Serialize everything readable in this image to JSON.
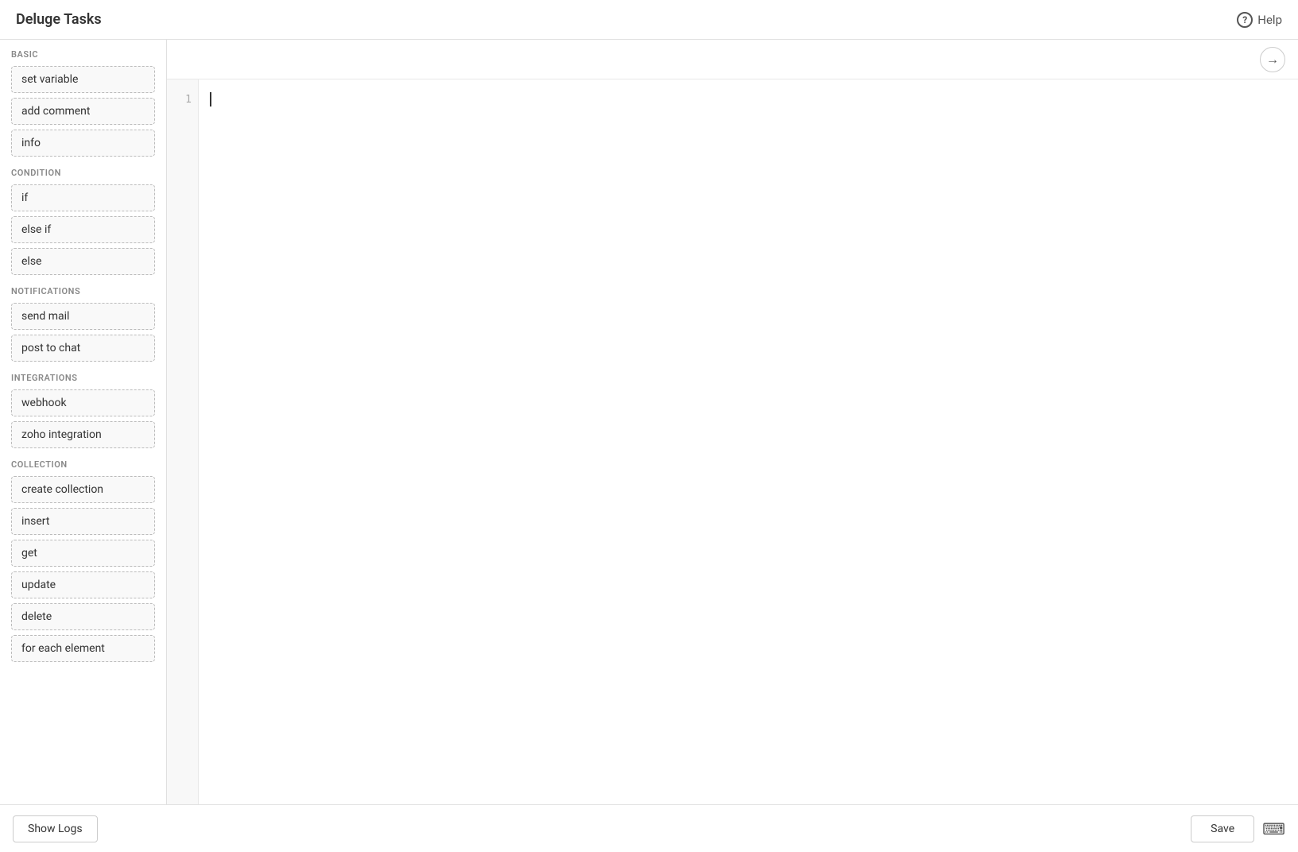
{
  "app": {
    "title": "Deluge Tasks",
    "help_label": "Help"
  },
  "sidebar": {
    "sections": [
      {
        "label": "BASIC",
        "id": "basic",
        "items": [
          {
            "id": "set-variable",
            "label": "set variable"
          },
          {
            "id": "add-comment",
            "label": "add comment"
          },
          {
            "id": "info",
            "label": "info"
          }
        ]
      },
      {
        "label": "CONDITION",
        "id": "condition",
        "items": [
          {
            "id": "if",
            "label": "if"
          },
          {
            "id": "else-if",
            "label": "else if"
          },
          {
            "id": "else",
            "label": "else"
          }
        ]
      },
      {
        "label": "NOTIFICATIONS",
        "id": "notifications",
        "items": [
          {
            "id": "send-mail",
            "label": "send mail"
          },
          {
            "id": "post-to-chat",
            "label": "post to chat"
          }
        ]
      },
      {
        "label": "INTEGRATIONS",
        "id": "integrations",
        "items": [
          {
            "id": "webhook",
            "label": "webhook"
          },
          {
            "id": "zoho-integration",
            "label": "zoho integration"
          }
        ]
      },
      {
        "label": "COLLECTION",
        "id": "collection",
        "items": [
          {
            "id": "create-collection",
            "label": "create collection"
          },
          {
            "id": "insert",
            "label": "insert"
          },
          {
            "id": "get",
            "label": "get"
          },
          {
            "id": "update",
            "label": "update"
          },
          {
            "id": "delete",
            "label": "delete"
          },
          {
            "id": "for-each-element",
            "label": "for each element"
          }
        ]
      }
    ]
  },
  "editor": {
    "line_number": "1"
  },
  "footer": {
    "show_logs_label": "Show Logs",
    "save_label": "Save",
    "keyboard_icon": "⌨"
  },
  "arrow": {
    "symbol": "→"
  }
}
